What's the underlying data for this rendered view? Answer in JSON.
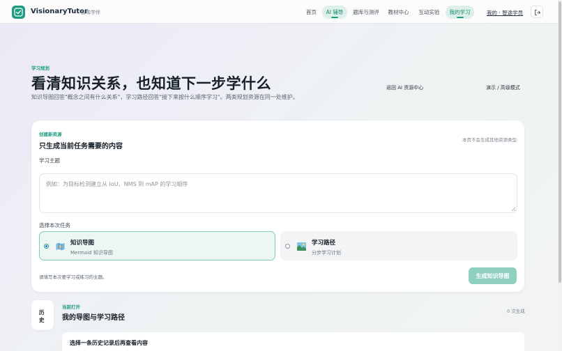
{
  "header": {
    "brand": "VisionaryTutor",
    "brand_sub": "智眸学伴",
    "nav": [
      {
        "label": "首页"
      },
      {
        "label": "AI 辅导"
      },
      {
        "label": "题库与测评"
      },
      {
        "label": "教材中心"
      },
      {
        "label": "互动实验"
      },
      {
        "label": "我的学习"
      }
    ],
    "user_link": "我的 · 智途学员"
  },
  "hero": {
    "eyebrow": "学习规划",
    "title": "看清知识关系，也知道下一步学什么",
    "description": "知识导图回答\"概念之间有什么关系\"，学习路径回答\"接下来按什么顺序学习\"。两类规划资源在同一处维护。",
    "back_link": "返回 AI 资源中心",
    "mode_link": "演示 / 高级模式"
  },
  "create": {
    "eyebrow": "创建新资源",
    "title": "只生成当前任务需要的内容",
    "note": "本页不会生成其他资源类型",
    "topic_label": "学习主题",
    "topic_value": "",
    "topic_placeholder": "例如：为目标检测建立从 IoU、NMS 到 mAP 的学习顺序",
    "task_label": "选择本次任务",
    "options": [
      {
        "title": "知识导图",
        "subtitle": "Mermaid 知识导图",
        "icon": "map-icon",
        "selected": true
      },
      {
        "title": "学习路径",
        "subtitle": "分步学习计划",
        "icon": "landscape-icon",
        "selected": false
      }
    ],
    "hint": "请填写本次要学习或练习的主题。",
    "submit_label": "生成知识导图"
  },
  "history": {
    "tab_chars": [
      "历",
      "史"
    ],
    "eyebrow": "当前打开",
    "title": "我的导图与学习路径",
    "count": "0 次生成",
    "empty_text": "选择一条历史记录后再查看内容"
  },
  "colors": {
    "accent": "#1f9b82",
    "accent_soft": "#dcefe9",
    "button_disabled": "#8fd0c1"
  }
}
